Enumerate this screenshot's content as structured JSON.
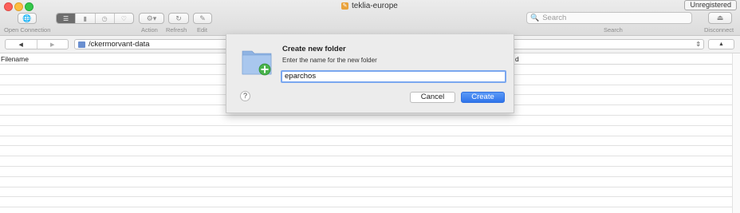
{
  "window": {
    "title": "teklia-europe",
    "registration_badge": "Unregistered"
  },
  "toolbar": {
    "open_connection_label": "Open Connection",
    "action_label": "Action",
    "refresh_label": "Refresh",
    "edit_label": "Edit",
    "search_label": "Search",
    "disconnect_label": "Disconnect",
    "search_placeholder": "Search"
  },
  "pathbar": {
    "current_path": "/ckermorvant-data"
  },
  "file_table": {
    "columns": [
      "Filename",
      "d"
    ]
  },
  "dialog": {
    "title": "Create new folder",
    "message": "Enter the name for the new folder",
    "input_value": "eparchos",
    "help_label": "?",
    "cancel_label": "Cancel",
    "create_label": "Create"
  },
  "colors": {
    "accent": "#2f74ea",
    "focus_ring": "#7aa7ef",
    "title_icon": "#e9a23b"
  }
}
